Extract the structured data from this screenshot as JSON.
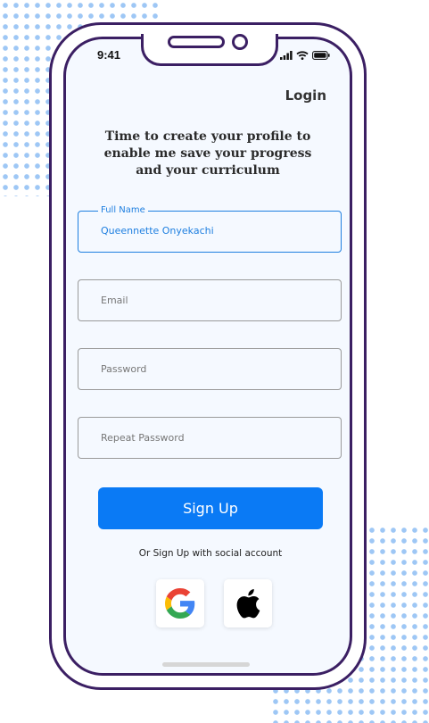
{
  "status_bar": {
    "time": "9:41",
    "icons": [
      "signal-icon",
      "wifi-icon",
      "battery-icon"
    ]
  },
  "header": {
    "login_label": "Login"
  },
  "headline": "Time to create your profile to enable me save your progress and your curriculum",
  "form": {
    "full_name": {
      "label": "Full Name",
      "value": "Queennette Onyekachi"
    },
    "email": {
      "placeholder": "Email"
    },
    "password": {
      "placeholder": "Password"
    },
    "repeat_password": {
      "placeholder": "Repeat Password"
    }
  },
  "signup_button": {
    "label": "Sign Up"
  },
  "social": {
    "prompt": "Or Sign Up with social account",
    "providers": [
      "google-icon",
      "apple-icon"
    ]
  },
  "colors": {
    "primary": "#0a7af5",
    "frame": "#3b1f63",
    "screen_bg": "#f5f9ff",
    "active_field": "#1e7fe0",
    "dots": "#9ec7f5"
  }
}
